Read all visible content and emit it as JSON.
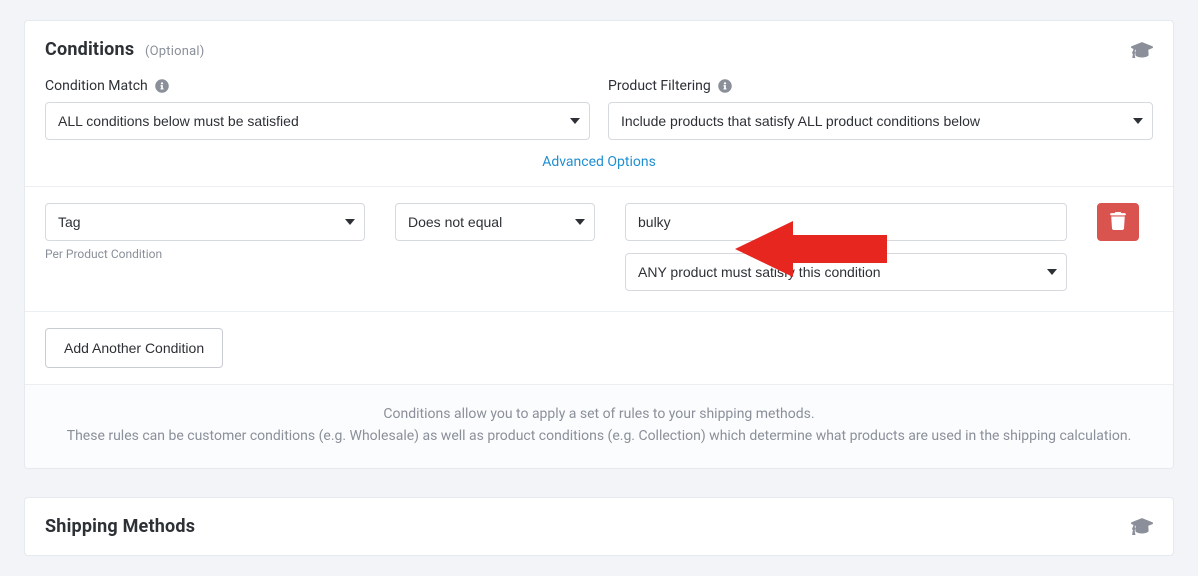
{
  "conditions_card": {
    "title": "Conditions",
    "optional_label": "(Optional)",
    "condition_match_label": "Condition Match",
    "condition_match_value": "ALL conditions below must be satisfied",
    "product_filtering_label": "Product Filtering",
    "product_filtering_value": "Include products that satisfy ALL product conditions below",
    "advanced_options_label": "Advanced Options",
    "row": {
      "field_value": "Tag",
      "per_product_label": "Per Product Condition",
      "operator_value": "Does not equal",
      "value_input": "bulky",
      "satisfy_value": "ANY product must satisfy this condition"
    },
    "add_button_label": "Add Another Condition",
    "help_line1": "Conditions allow you to apply a set of rules to your shipping methods.",
    "help_line2": "These rules can be customer conditions (e.g. Wholesale) as well as product conditions (e.g. Collection) which determine what products are used in the shipping calculation."
  },
  "shipping_card": {
    "title": "Shipping Methods"
  },
  "arrow_color": "#e6261f"
}
